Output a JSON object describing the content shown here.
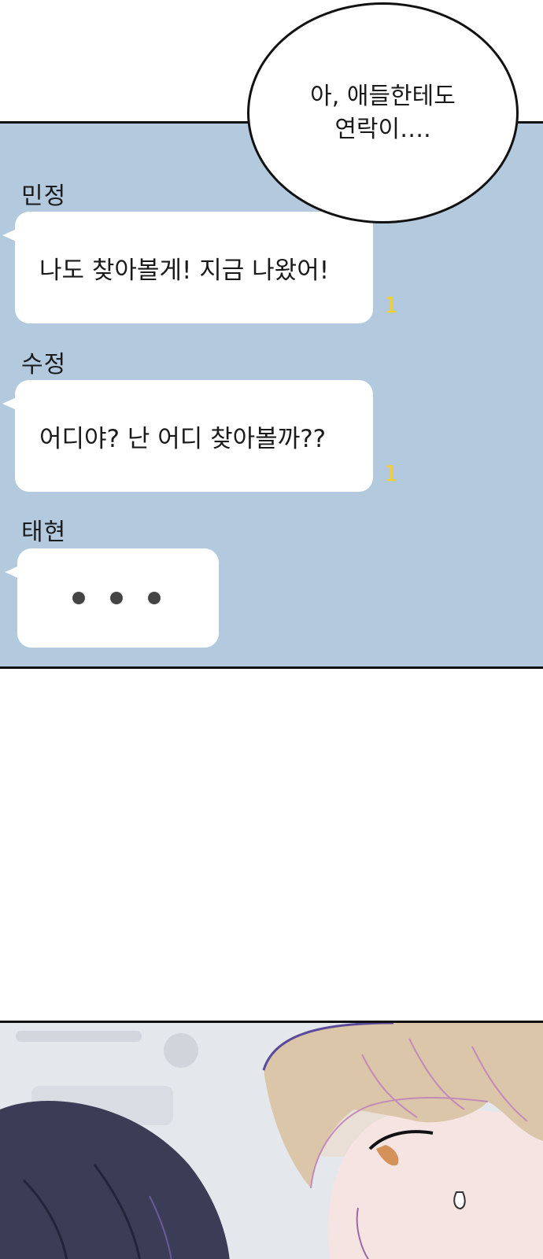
{
  "speech_bubble": {
    "line1": "아, 애들한테도",
    "line2": "연락이…."
  },
  "messages": [
    {
      "sender": "민정",
      "text": "나도 찾아볼게! 지금 나왔어!",
      "unread": "1"
    },
    {
      "sender": "수정",
      "text": "어디야? 난 어디 찾아볼까??",
      "unread": "1"
    },
    {
      "sender": "태현",
      "typing": true
    }
  ],
  "colors": {
    "chat_background": "#b3c9de",
    "bubble": "#ffffff",
    "unread_count": "#f2cf2e",
    "panel_border": "#111111"
  }
}
